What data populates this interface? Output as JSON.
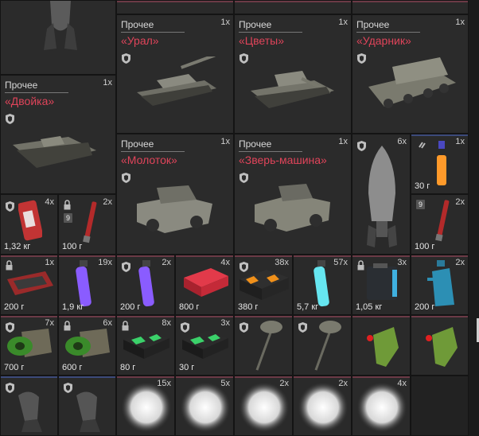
{
  "category_label": "Прочее",
  "vehicles": [
    {
      "id": "ural",
      "name": "«Урал»",
      "count": "1x"
    },
    {
      "id": "tsvety",
      "name": "«Цветы»",
      "count": "1x"
    },
    {
      "id": "udarnik",
      "name": "«Ударник»",
      "count": "1x"
    },
    {
      "id": "dvoika",
      "name": "«Двойка»",
      "count": "1x"
    },
    {
      "id": "molotok",
      "name": "«Молоток»",
      "count": "1x"
    },
    {
      "id": "zver",
      "name": "«Зверь-машина»",
      "count": "1x"
    }
  ],
  "items": {
    "can": {
      "count": "4x",
      "weight": "1,32 кг"
    },
    "red_stick": {
      "count": "2x",
      "weight": "100 г",
      "level": "9"
    },
    "bomb": {
      "count": "6x"
    },
    "orange_stick": {
      "count": "1x",
      "weight": "30 г"
    },
    "red_stick_2": {
      "count": "2x",
      "weight": "100 г",
      "level": "9"
    },
    "red_case": {
      "count": "1x",
      "weight": "200 г"
    },
    "purple_tube_1": {
      "count": "19x",
      "weight": "1,9 кг"
    },
    "purple_tube_2": {
      "count": "2x",
      "weight": "200 г"
    },
    "red_box": {
      "count": "4x",
      "weight": "800 г"
    },
    "orange_crate": {
      "count": "38x",
      "weight": "380 г"
    },
    "cyan_tube": {
      "count": "57x",
      "weight": "5,7 кг"
    },
    "battery": {
      "count": "3x",
      "weight": "1,05 кг"
    },
    "bottle": {
      "count": "2x",
      "weight": "200 г"
    },
    "green_crate_1": {
      "count": "7x",
      "weight": "700 г"
    },
    "green_crate_2": {
      "count": "6x",
      "weight": "600 г"
    },
    "green_case_1": {
      "count": "8x",
      "weight": "80 г"
    },
    "green_case_2": {
      "count": "3x",
      "weight": "30 г"
    },
    "smoke_1": {
      "count": "15x"
    },
    "smoke_2": {
      "count": "5x"
    },
    "smoke_3": {
      "count": "2x"
    },
    "smoke_4": {
      "count": "2x"
    },
    "smoke_5": {
      "count": "4x"
    }
  },
  "colors": {
    "accent_red": "#e0445a",
    "border_red": "#6b3a46",
    "border_blue": "#3c4a7a"
  }
}
